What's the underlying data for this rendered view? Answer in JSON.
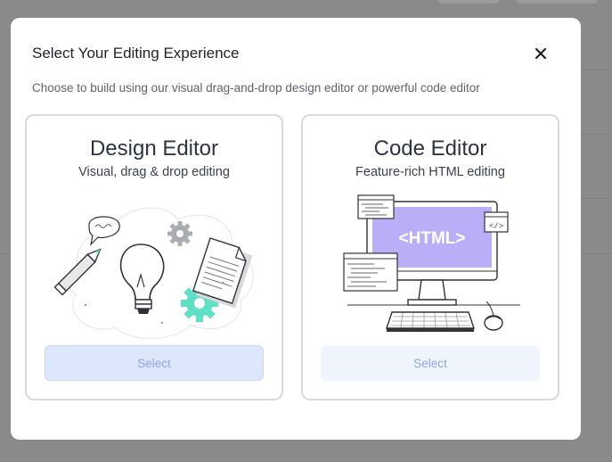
{
  "modal": {
    "title": "Select Your Editing Experience",
    "subtitle": "Choose to build using our visual drag-and-drop design editor or powerful code editor",
    "close_icon": "close-icon"
  },
  "cards": [
    {
      "title": "Design Editor",
      "subtitle": "Visual, drag & drop editing",
      "select_label": "Select",
      "illustration": "lightbulb-gear-document-illustration"
    },
    {
      "title": "Code Editor",
      "subtitle": "Feature-rich HTML editing",
      "select_label": "Select",
      "monitor_text": "<HTML>",
      "code_badge": "</>",
      "illustration": "computer-monitor-illustration"
    }
  ],
  "colors": {
    "accent": "#b9aef7",
    "gear": "#5fe0c4",
    "button_text": "#8ba6e6",
    "overlay": "#8a8a8a"
  }
}
